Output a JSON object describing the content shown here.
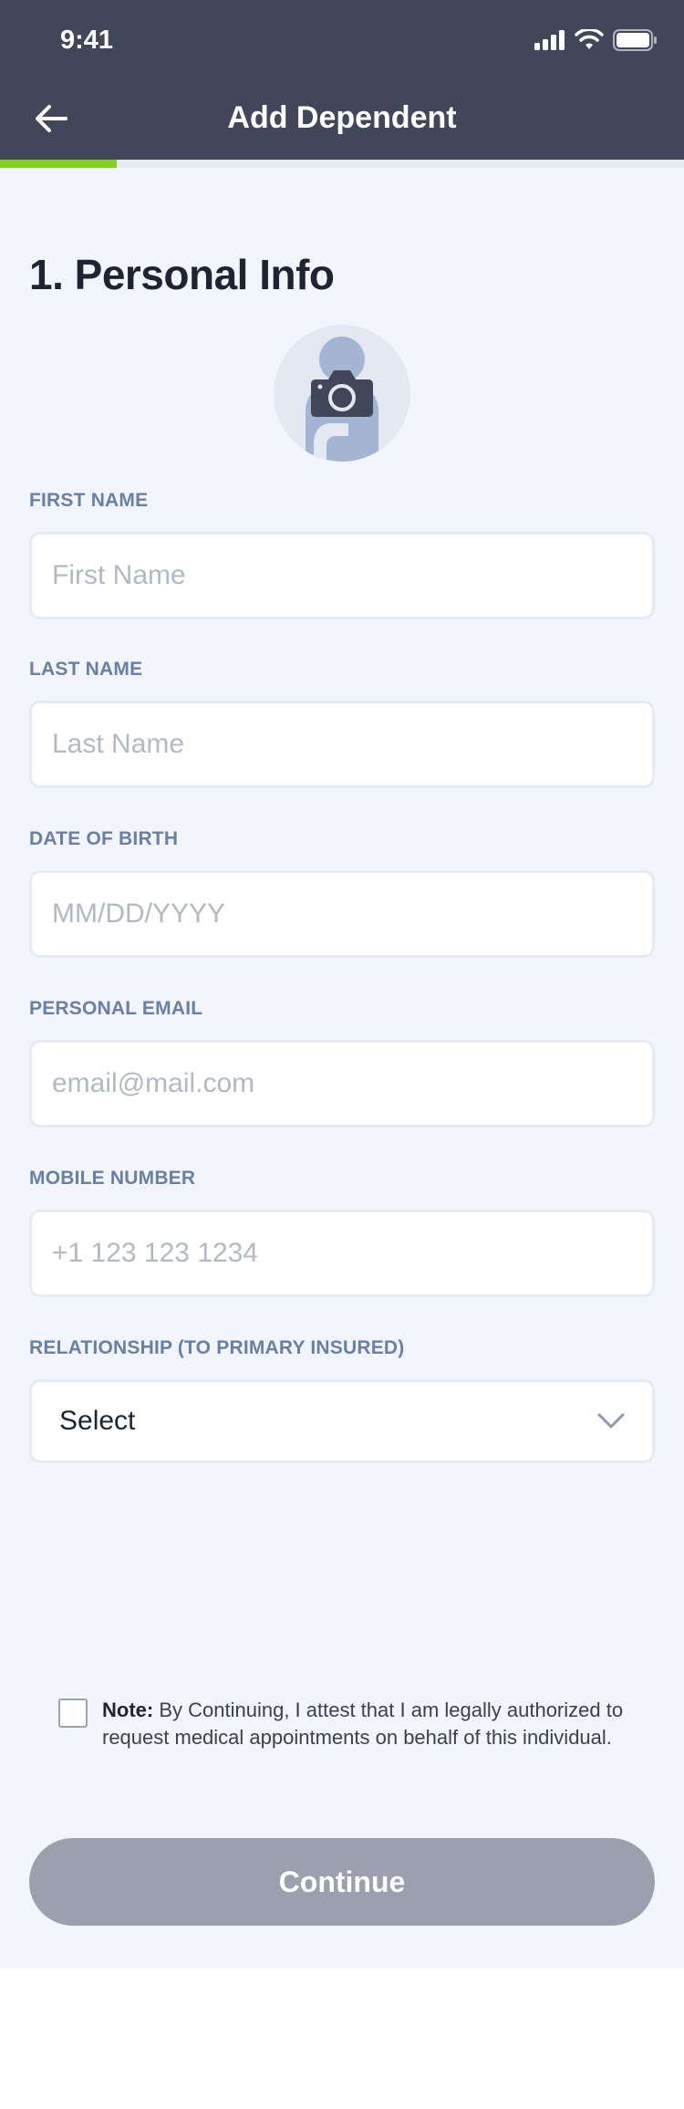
{
  "status_bar": {
    "time": "9:41"
  },
  "header": {
    "title": "Add Dependent",
    "back_icon": "arrow-left-icon"
  },
  "progress": {
    "value_percent": 17,
    "color": "#7ed321"
  },
  "section": {
    "title": "1. Personal Info"
  },
  "avatar": {
    "icon": "camera-icon"
  },
  "fields": {
    "first_name": {
      "label": "FIRST NAME",
      "placeholder": "First Name"
    },
    "last_name": {
      "label": "LAST NAME",
      "placeholder": "Last Name"
    },
    "dob": {
      "label": "DATE OF BIRTH",
      "placeholder": "MM/DD/YYYY"
    },
    "email": {
      "label": "PERSONAL EMAIL",
      "placeholder": "email@mail.com"
    },
    "mobile": {
      "label": "MOBILE NUMBER",
      "placeholder": "+1 123 123 1234"
    },
    "relationship": {
      "label": "RELATIONSHIP (TO PRIMARY INSURED)",
      "value": "Select"
    }
  },
  "note": {
    "bold": "Note:",
    "text": "By Continuing, I attest that I am legally authorized to request medical appointments on behalf of this individual.",
    "checked": false
  },
  "continue_label": "Continue",
  "colors": {
    "header": "#414759",
    "accent": "#7ed321",
    "label": "#6b7fa6",
    "button_disabled": "#9aa0ad"
  }
}
